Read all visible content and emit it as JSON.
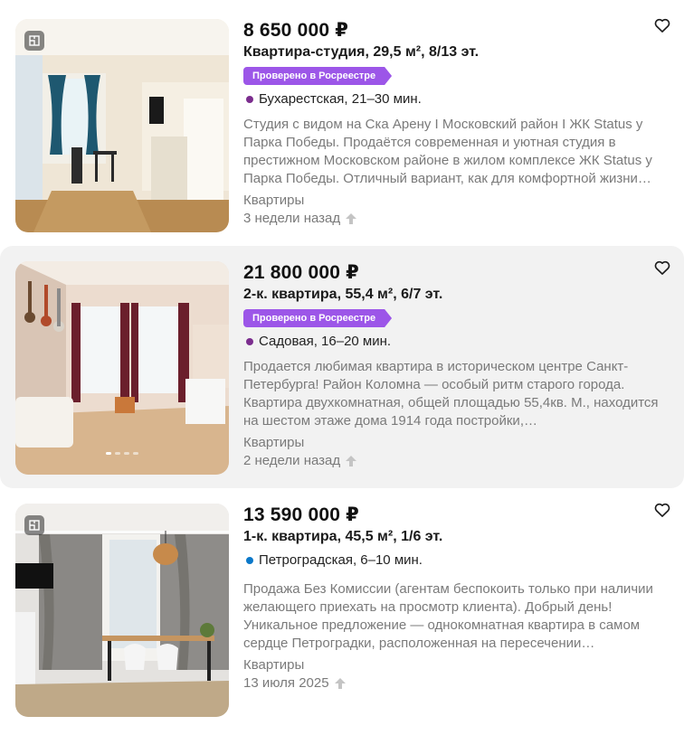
{
  "listings": [
    {
      "price": "8 650 000 ₽",
      "title": "Квартира-студия, 29,5 м², 8/13 эт.",
      "verified": "Проверено в Росреестре",
      "metro": "Бухарестская, 21–30 мин.",
      "metro_color": "#7b2d8e",
      "description": "Студия с видом на Ска Арену I Московский район I ЖК Status у Парка Победы. Продаётся современная и уютная студия в престижном Московском районе в жилом комплексе ЖК Status у Парка Победы. Отличный вариант, как для комфортной жизни…",
      "category": "Квартиры",
      "date": "3 недели назад",
      "photo_icon": "floorplan-icon"
    },
    {
      "price": "21 800 000 ₽",
      "title": "2-к. квартира, 55,4 м², 6/7 эт.",
      "verified": "Проверено в Росреестре",
      "metro": "Садовая, 16–20 мин.",
      "metro_color": "#7b2d8e",
      "description": "Продается любимая квартира в историческом центре Санкт-Петербурга! Район Коломна — особый ритм старого города. Квартира двухкомнатная, общей площадью 55,4кв. М., находится на шестом этаже дома 1914 года постройки,…",
      "category": "Квартиры",
      "date": "2 недели назад"
    },
    {
      "price": "13 590 000 ₽",
      "title": "1-к. квартира, 45,5 м², 1/6 эт.",
      "metro": "Петроградская, 6–10 мин.",
      "metro_color": "#0a78c9",
      "description": "Продажа Без Комиссии (агентам беспокоить только при наличии желающего приехать на просмотр клиента). Добрый день! Уникальное предложение — однокомнатная квартира в самом сердце Петроградки, расположенная на пересечении…",
      "category": "Квартиры",
      "date": "13 июля 2025",
      "photo_icon": "floorplan-icon"
    }
  ],
  "colors": {
    "verified_bg": "#9c56e8",
    "muted_text": "#7a7a7a",
    "highlight_bg": "#f2f2f2"
  }
}
